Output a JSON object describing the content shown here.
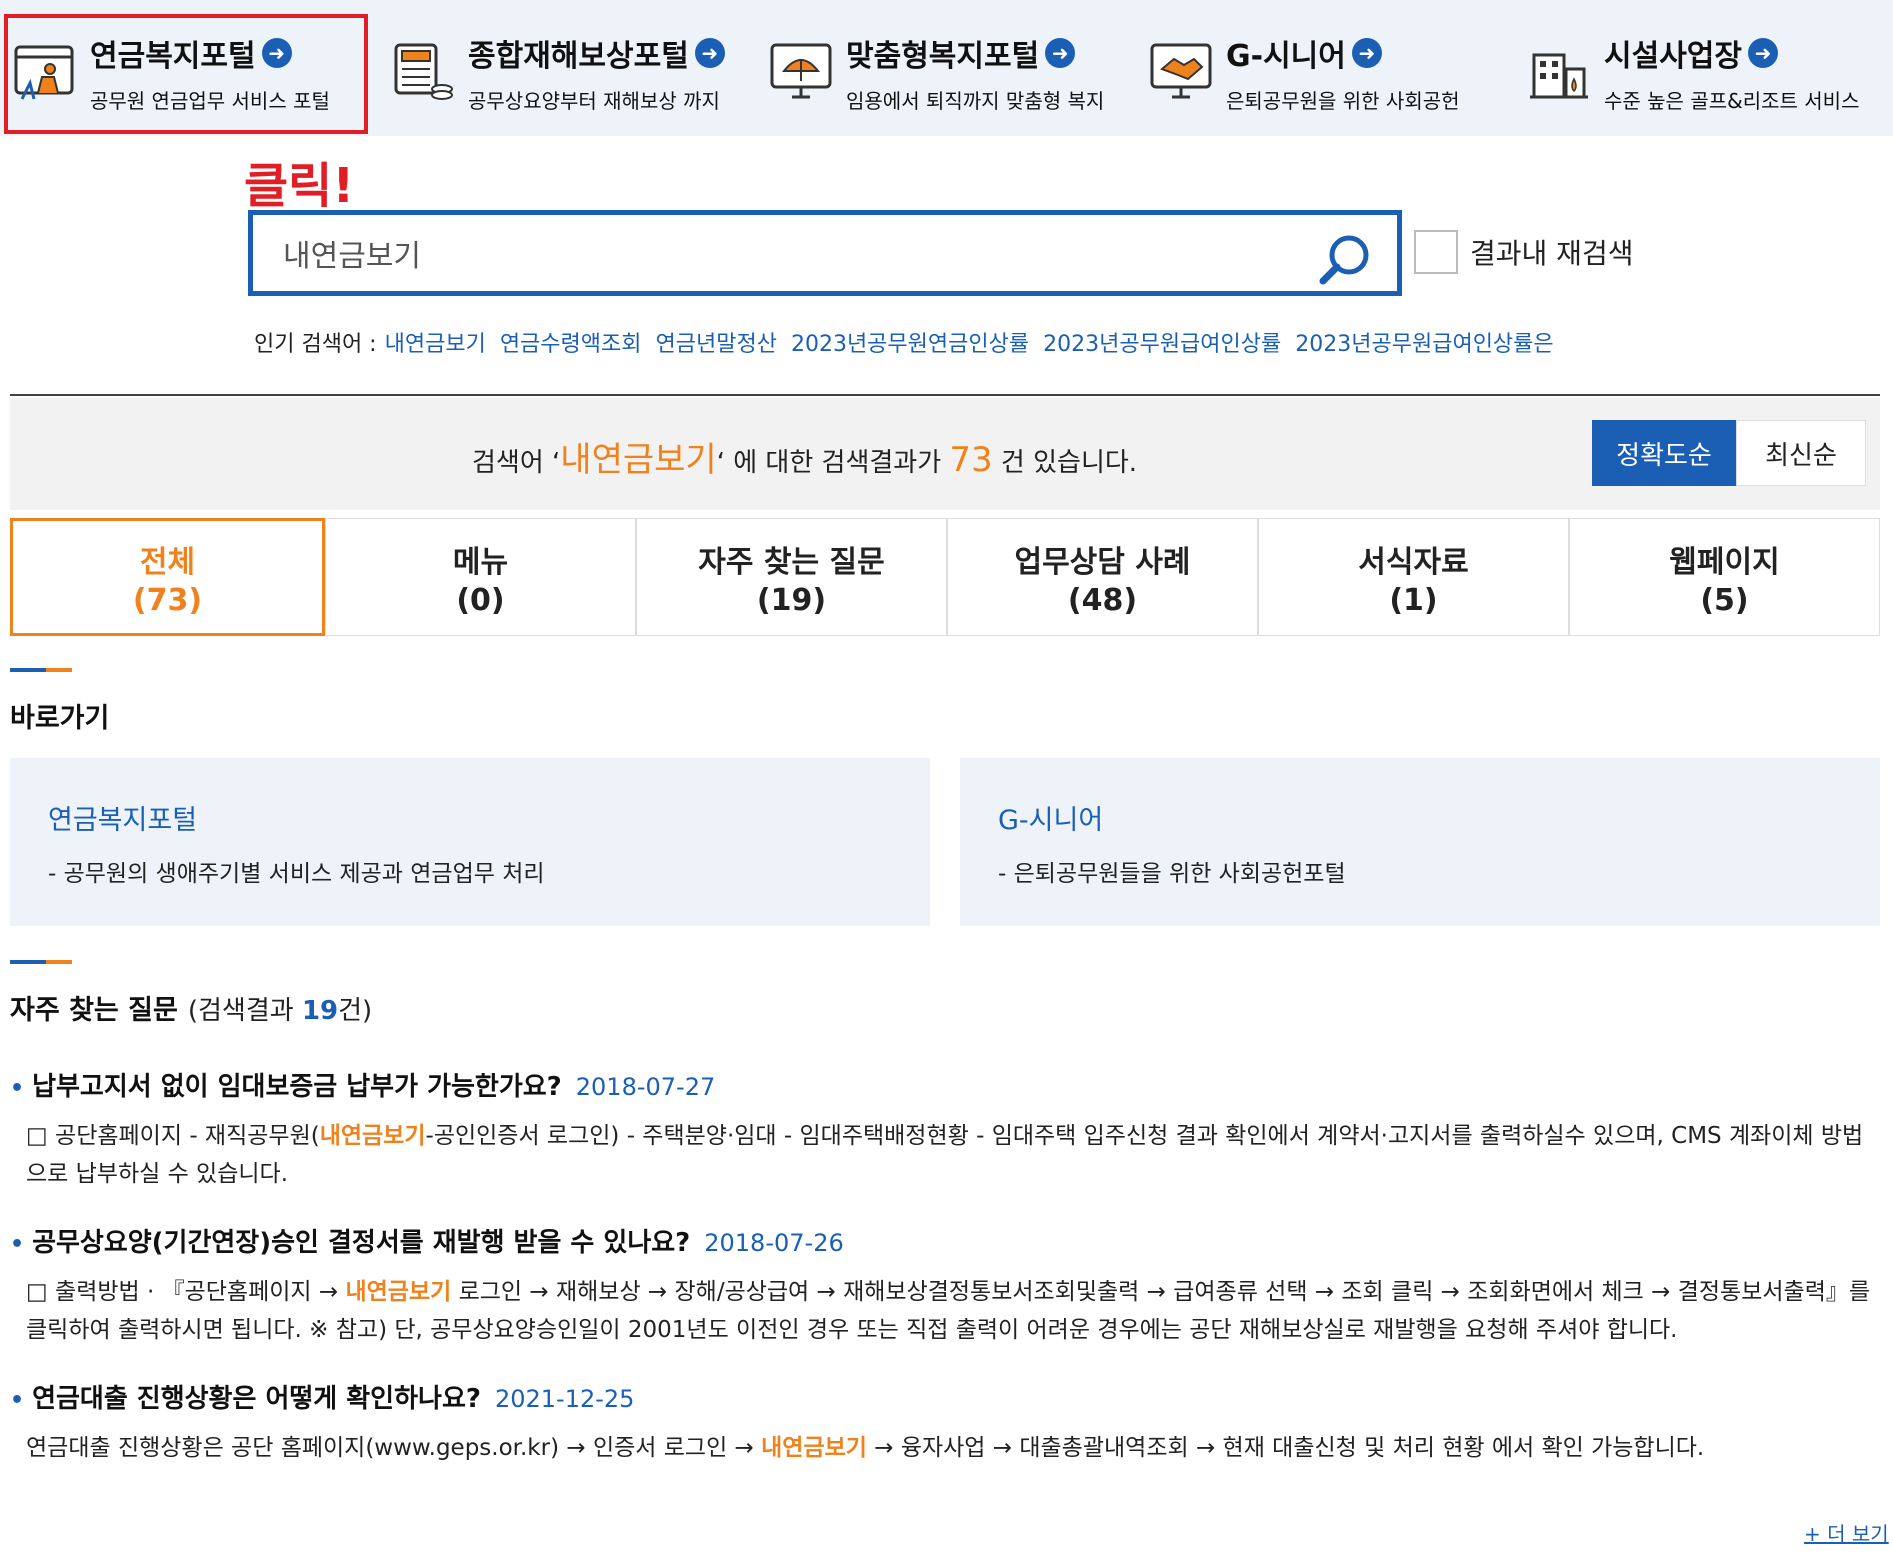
{
  "portals": [
    {
      "title": "연금복지포털",
      "subtitle": "공무원 연금업무 서비스 포털",
      "icon": "pension-worker-icon"
    },
    {
      "title": "종합재해보상포털",
      "subtitle": "공무상요양부터 재해보상 까지",
      "icon": "calculator-coins-icon"
    },
    {
      "title": "맞춤형복지포털",
      "subtitle": "임용에서 퇴직까지 맞춤형 복지",
      "icon": "umbrella-monitor-icon"
    },
    {
      "title": "G-시니어",
      "subtitle": "은퇴공무원을 위한 사회공헌",
      "icon": "handshake-monitor-icon"
    },
    {
      "title": "시설사업장",
      "subtitle": "수준 높은 골프&리조트 서비스",
      "icon": "building-icon"
    }
  ],
  "annotation": {
    "click_note": "클릭!"
  },
  "search": {
    "value": "내연금보기",
    "recheck_label": "결과내 재검색"
  },
  "popular": {
    "label": "인기 검색어 :",
    "terms": [
      "내연금보기",
      "연금수령액조회",
      "연금년말정산",
      "2023년공무원연금인상률",
      "2023년공무원급여인상률",
      "2023년공무원급여인상률은"
    ]
  },
  "summary": {
    "prefix": "검색어 ‘",
    "keyword": "내연금보기",
    "middle": "‘ 에 대한 검색결과가 ",
    "count": "73",
    "suffix": " 건 있습니다.",
    "sort_accuracy": "정확도순",
    "sort_recent": "최신순"
  },
  "tabs": [
    {
      "label": "전체",
      "count": "(73)"
    },
    {
      "label": "메뉴",
      "count": "(0)"
    },
    {
      "label": "자주 찾는 질문",
      "count": "(19)"
    },
    {
      "label": "업무상담 사례",
      "count": "(48)"
    },
    {
      "label": "서식자료",
      "count": "(1)"
    },
    {
      "label": "웹페이지",
      "count": "(5)"
    }
  ],
  "shortcuts": {
    "heading": "바로가기",
    "items": [
      {
        "title": "연금복지포털",
        "desc": "- 공무원의 생애주기별 서비스 제공과 연금업무 처리"
      },
      {
        "title": "G-시니어",
        "desc": "- 은퇴공무원들을 위한 사회공헌포털"
      }
    ]
  },
  "faq": {
    "heading": "자주 찾는 질문",
    "meta_prefix": "(검색결과 ",
    "meta_count": "19",
    "meta_suffix": "건)",
    "items": [
      {
        "question": "납부고지서 없이 임대보증금 납부가 가능한가요?",
        "date": "2018-07-27",
        "answer_pre": "□ 공단홈페이지 - 재직공무원(",
        "answer_hl": "내연금보기",
        "answer_post": "-공인인증서 로그인) - 주택분양·임대 - 임대주택배정현황 - 임대주택 입주신청 결과 확인에서 계약서·고지서를 출력하실수 있으며, CMS 계좌이체 방법으로 납부하실 수 있습니다."
      },
      {
        "question": "공무상요양(기간연장)승인 결정서를 재발행 받을 수 있나요?",
        "date": "2018-07-26",
        "answer_pre": "□ 출력방법 · 『공단홈페이지 → ",
        "answer_hl": "내연금보기",
        "answer_post": " 로그인 → 재해보상 → 장해/공상급여 → 재해보상결정통보서조회및출력 → 급여종류 선택 → 조회 클릭 → 조회화면에서 체크 → 결정통보서출력』를 클릭하여 출력하시면 됩니다. ※ 참고) 단, 공무상요양승인일이 2001년도 이전인 경우 또는 직접 출력이 어려운 경우에는 공단 재해보상실로 재발행을 요청해 주셔야 합니다."
      },
      {
        "question": "연금대출 진행상황은 어떻게 확인하나요?",
        "date": "2021-12-25",
        "answer_pre": "연금대출 진행상황은 공단 홈페이지(www.geps.or.kr) → 인증서 로그인 → ",
        "answer_hl": "내연금보기",
        "answer_post": " → 융자사업 → 대출총괄내역조회 → 현재 대출신청 및 처리 현황 에서 확인 가능합니다."
      }
    ],
    "more_label": "+ 더 보기"
  },
  "colors": {
    "primary": "#1b5fb5",
    "accent": "#f0821e",
    "annotation_red": "#e01e26",
    "portal_bg": "#eef3fa"
  }
}
